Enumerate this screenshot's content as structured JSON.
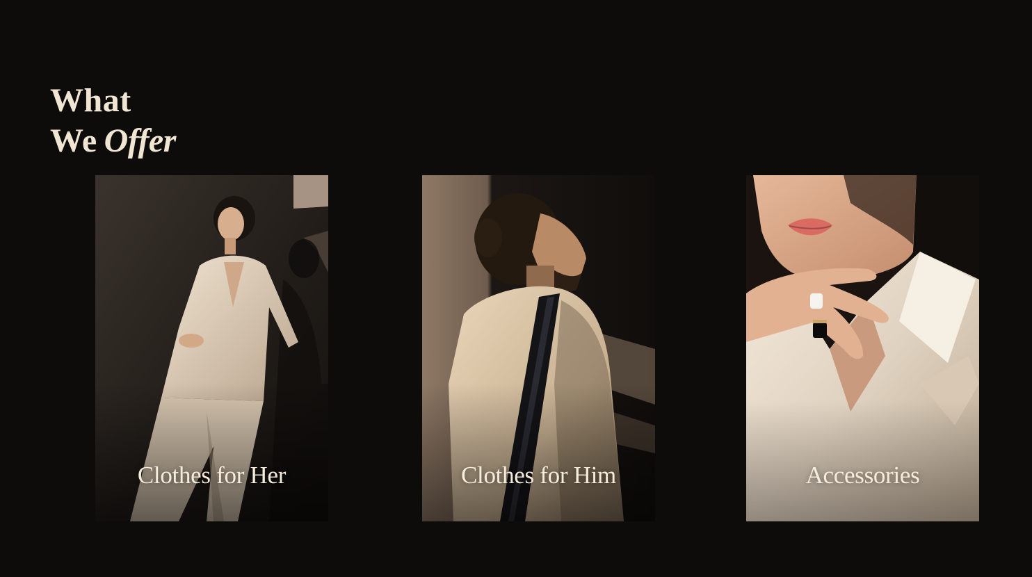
{
  "section": {
    "heading_line1": "What",
    "heading_line2_plain": "We",
    "heading_line2_italic": "Offer"
  },
  "cards": [
    {
      "label": "Clothes for Her"
    },
    {
      "label": "Clothes for Him"
    },
    {
      "label": "Accessories"
    }
  ],
  "colors": {
    "background": "#0e0c0b",
    "heading_text": "#f1e6d4",
    "card_label": "#f6ecdc"
  }
}
